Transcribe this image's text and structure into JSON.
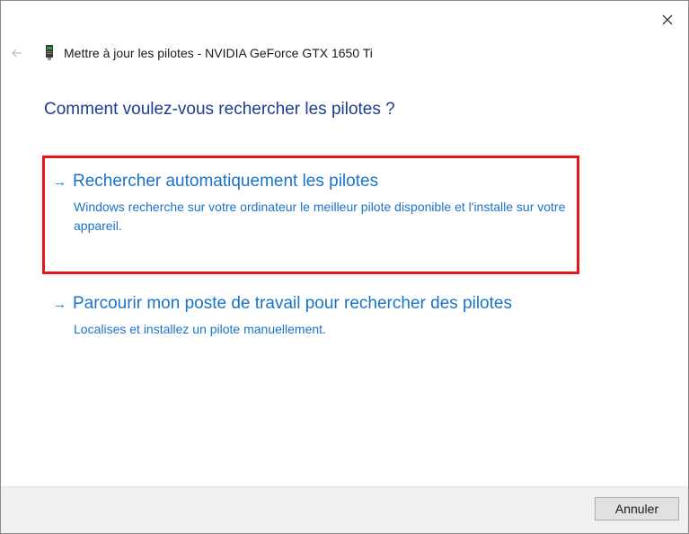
{
  "window": {
    "title": "Mettre à jour les pilotes - NVIDIA GeForce GTX 1650 Ti",
    "question": "Comment voulez-vous rechercher les pilotes ?"
  },
  "icons": {
    "close": "close-icon",
    "back": "back-arrow-icon",
    "device": "graphics-card-icon",
    "option_arrow": "right-arrow-icon"
  },
  "options": [
    {
      "arrow": "→",
      "title": "Rechercher automatiquement les pilotes",
      "description": "Windows recherche sur votre ordinateur le meilleur pilote disponible et l'installe sur votre appareil."
    },
    {
      "arrow": "→",
      "title": "Parcourir mon poste de travail pour rechercher des pilotes",
      "description": "Localises et installez un pilote manuellement."
    }
  ],
  "footer": {
    "cancel_label": "Annuler"
  },
  "colors": {
    "accent": "#1a73c9",
    "heading": "#1f3d8f",
    "highlight": "#e8141c",
    "footer_bg": "#f0f0f0"
  }
}
